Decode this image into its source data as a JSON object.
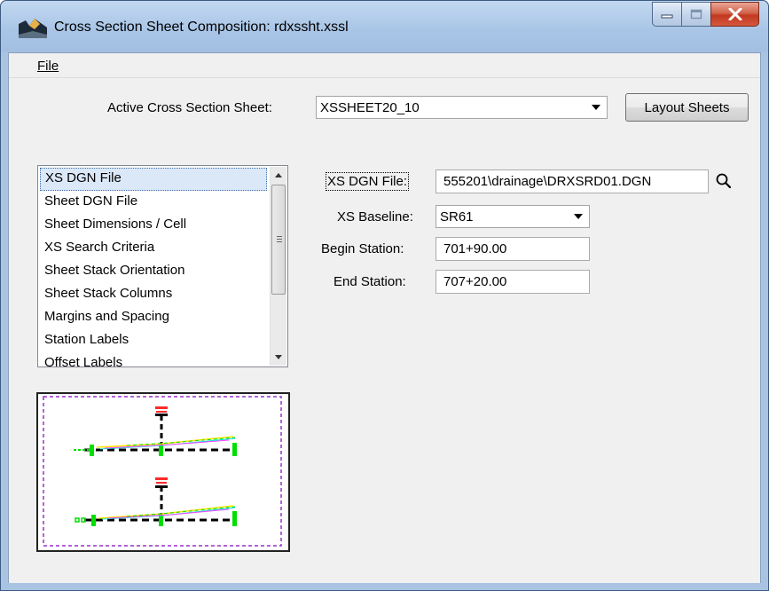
{
  "window": {
    "title": "Cross Section Sheet Composition: rdxssht.xssl",
    "icons": {
      "app": "app-icon",
      "minimize": "minimize-icon",
      "maximize": "maximize-icon",
      "close": "close-icon"
    }
  },
  "menu": {
    "file_label": "File"
  },
  "sheet": {
    "label": "Active Cross Section Sheet:",
    "selected": "XSSHEET20_10",
    "layout_button": "Layout Sheets"
  },
  "list": {
    "items": [
      "XS DGN File",
      "Sheet DGN File",
      "Sheet Dimensions / Cell",
      "XS Search Criteria",
      "Sheet Stack Orientation",
      "Sheet Stack Columns",
      "Margins and Spacing",
      "Station Labels",
      "Offset Labels"
    ],
    "selected_index": 0
  },
  "form": {
    "xs_dgn_label": "XS DGN File:",
    "xs_dgn_value": "555201\\drainage\\DRXSRD01.DGN",
    "xs_baseline_label": "XS Baseline:",
    "xs_baseline_value": "SR61",
    "begin_label": "Begin Station:",
    "begin_value": "701+90.00",
    "end_label": "End Station:",
    "end_value": "707+20.00",
    "browse_icon": "search-icon"
  },
  "colors": {
    "title_bg": "#a8c4e6",
    "close_red": "#c2391f",
    "selection": "#dbe8f7",
    "preview_border_dash": "#9b30c8",
    "xs_green": "#00e000",
    "xs_red": "#ff0000"
  }
}
